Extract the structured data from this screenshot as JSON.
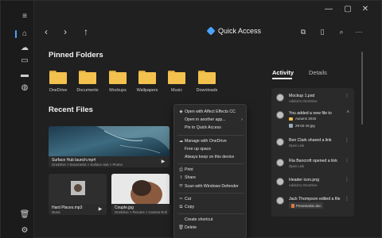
{
  "window": {
    "controls": [
      {
        "name": "minimize-icon",
        "glyph": "—"
      },
      {
        "name": "maximize-icon",
        "glyph": "▢"
      },
      {
        "name": "close-icon",
        "glyph": "✕"
      }
    ]
  },
  "rail": {
    "items": [
      {
        "name": "hamburger-menu-icon",
        "glyph": "≡"
      },
      {
        "name": "home-icon",
        "glyph": "⌂"
      },
      {
        "name": "cloud-icon",
        "glyph": "☁"
      },
      {
        "name": "computer-icon",
        "glyph": "▭"
      },
      {
        "name": "drive-icon",
        "glyph": "▬"
      },
      {
        "name": "network-icon",
        "glyph": "◍"
      },
      {
        "name": "trash-icon",
        "glyph": "🗑"
      },
      {
        "name": "settings-gear-icon",
        "glyph": "⚙"
      }
    ],
    "accent": "#4aa3ff"
  },
  "cmdbar": {
    "back": "‹",
    "forward": "›",
    "up": "↑",
    "title": "Quick Access",
    "tools": [
      {
        "name": "library-icon",
        "glyph": "⧉"
      },
      {
        "name": "tablet-icon",
        "glyph": "▯"
      },
      {
        "name": "search-icon",
        "glyph": "⌕"
      },
      {
        "name": "more-options-icon",
        "glyph": "···"
      }
    ]
  },
  "pinned": {
    "heading": "Pinned Folders",
    "folders": [
      "OneDrive",
      "Documents",
      "Mockups",
      "Wallpapers",
      "Music",
      "Downloads"
    ]
  },
  "recent": {
    "heading": "Recent Files",
    "cards": [
      {
        "name": "Surface Hub launch.mp4",
        "path": "OneDrive > Documents > Surface Hub > Promo"
      },
      {
        "name": "Hard Places.mp3",
        "path": "Music"
      },
      {
        "name": "Couple.jpg",
        "path": "OneDrive > Pictures > Camera Roll"
      }
    ]
  },
  "context_menu": {
    "items": [
      {
        "icon": "app-icon",
        "glyph": "◆",
        "label": "Open with Affect Effects CC"
      },
      {
        "icon": "",
        "glyph": "",
        "label": "Open in another app...",
        "arrow": "›"
      },
      {
        "icon": "",
        "glyph": "",
        "label": "Pin to Quick Access"
      },
      {
        "sep": true
      },
      {
        "icon": "cloud-icon",
        "glyph": "☁",
        "label": "Manage with OneDrive"
      },
      {
        "icon": "",
        "glyph": "",
        "label": "Free up space"
      },
      {
        "icon": "",
        "glyph": "",
        "label": "Always keep on this device"
      },
      {
        "sep": true
      },
      {
        "icon": "print-icon",
        "glyph": "⎙",
        "label": "Print"
      },
      {
        "icon": "share-icon",
        "glyph": "⇪",
        "label": "Share"
      },
      {
        "icon": "shield-icon",
        "glyph": "⛨",
        "label": "Scan with Windows Defender"
      },
      {
        "sep": true
      },
      {
        "icon": "cut-icon",
        "glyph": "✂",
        "label": "Cut"
      },
      {
        "icon": "copy-icon",
        "glyph": "⧉",
        "label": "Copy"
      },
      {
        "sep": true
      },
      {
        "icon": "",
        "glyph": "",
        "label": "Create shortcut"
      },
      {
        "icon": "delete-icon",
        "glyph": "🗑",
        "label": "Delete"
      }
    ]
  },
  "activity": {
    "tabs": [
      "Activity",
      "Details"
    ],
    "entries": [
      {
        "title": "Mockup 1.psd",
        "sub": "Added to OneDrive"
      },
      {
        "title": "You added a new file to",
        "sub": "",
        "folder": "Autumn 2019",
        "file": "29-02-19.jpg"
      },
      {
        "title": "Ben Clark shared a link",
        "sub": "Open Link"
      },
      {
        "title": "Ria Bancroft opened a link",
        "sub": "Open Link"
      },
      {
        "title": "Header icon.png",
        "sub": "Added to OneDrive"
      },
      {
        "title": "Jack Thompson edited a file",
        "sub": "",
        "chip": "Presentation.doc"
      }
    ]
  }
}
